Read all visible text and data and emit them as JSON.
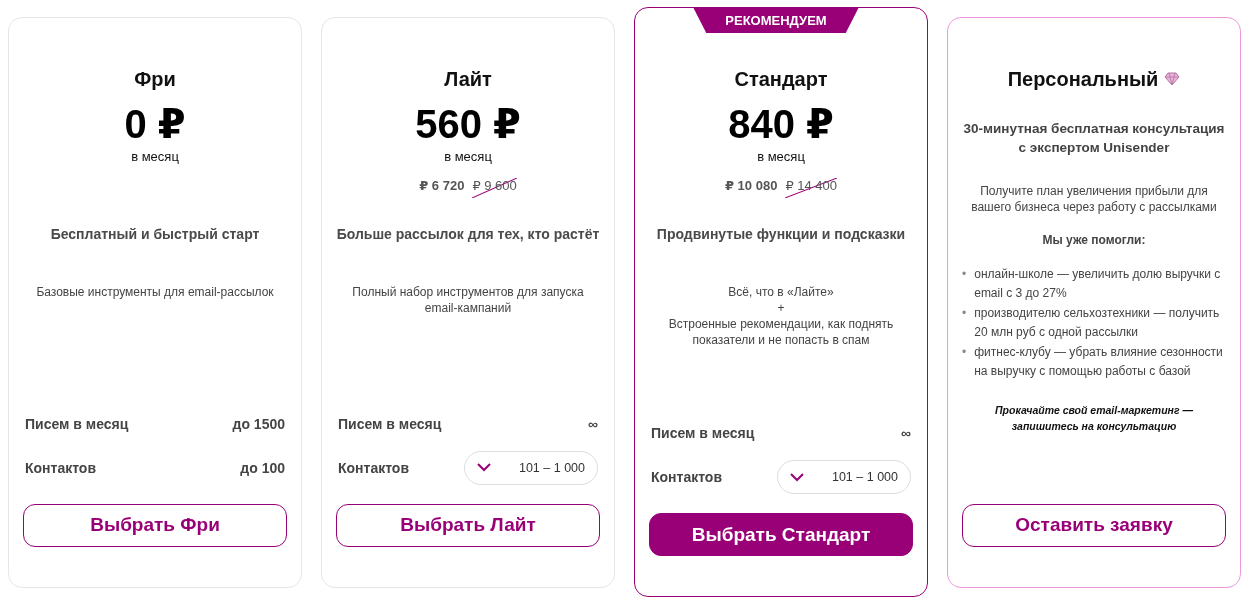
{
  "plans": [
    {
      "kind": "standard",
      "name": "Фри",
      "price": "0 ₽",
      "period": "в месяц",
      "tagline": "Бесплатный и быстрый старт",
      "description": [
        "Базовые инструменты для email-рассылок"
      ],
      "rows": [
        {
          "label": "Писем в месяц",
          "kind": "text",
          "value": "до 1500"
        },
        {
          "label": "Контактов",
          "kind": "text",
          "value": "до 100"
        }
      ],
      "button": "Выбрать Фри"
    },
    {
      "kind": "standard",
      "name": "Лайт",
      "price": "560 ₽",
      "period": "в месяц",
      "annual": {
        "current": "₽ 6 720",
        "old": "₽ 9 600"
      },
      "tagline": "Больше рассылок для тех, кто растёт",
      "description": [
        "Полный набор инструментов для запуска email-кампаний"
      ],
      "rows": [
        {
          "label": "Писем в месяц",
          "kind": "text",
          "value": "∞"
        },
        {
          "label": "Контактов",
          "kind": "dropdown",
          "value": "101 – 1 000"
        }
      ],
      "button": "Выбрать Лайт"
    },
    {
      "kind": "standard",
      "badge": "РЕКОМЕНДУЕМ",
      "name": "Стандарт",
      "price": "840 ₽",
      "period": "в месяц",
      "annual": {
        "current": "₽ 10 080",
        "old": "₽ 14 400"
      },
      "tagline": "Продвинутые функции и подсказки",
      "description": [
        "Всё, что в «Лайте»",
        "+",
        "Встроенные рекомендации, как поднять показатели и не попасть в спам"
      ],
      "rows": [
        {
          "label": "Писем в месяц",
          "kind": "text",
          "value": "∞"
        },
        {
          "label": "Контактов",
          "kind": "dropdown",
          "value": "101 – 1 000"
        }
      ],
      "button": "Выбрать Стандарт"
    },
    {
      "kind": "personal",
      "name": "Персональный",
      "subtitle": "30-минутная бесплатная консультация с экспертом Unisender",
      "intro": "Получите план увеличения прибыли для вашего бизнеса через работу с рассылками",
      "list_title": "Мы уже помогли:",
      "list": [
        {
          "marker": "•",
          "text": "онлайн-школе — увеличить долю выручки с email с 3 до 27%"
        },
        {
          "marker": "•",
          "text": "производителю сельхозтехники — получить 20 млн руб с одной рассылки"
        },
        {
          "marker": "•",
          "text": "фитнес-клубу — убрать влияние сезонности на выручку с помощью работы с базой"
        }
      ],
      "footer": "Прокачайте свой email-маркетинг — запишитесь на консультацию",
      "button": "Оставить заявку"
    }
  ]
}
